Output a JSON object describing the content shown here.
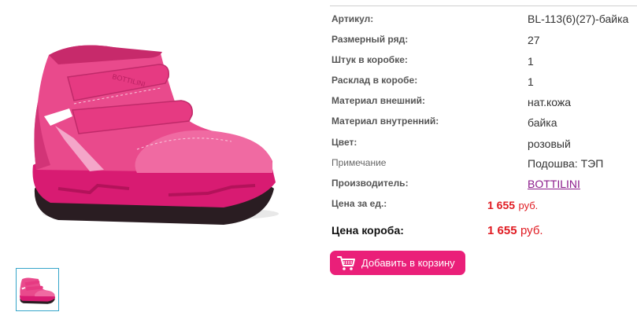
{
  "specs": [
    {
      "label": "Артикул:",
      "value": "BL-113(6)(27)-байка"
    },
    {
      "label": "Размерный ряд:",
      "value": "27"
    },
    {
      "label": "Штук в коробке:",
      "value": "1"
    },
    {
      "label": "Расклад в коробе:",
      "value": "1"
    },
    {
      "label": "Материал внешний:",
      "value": "нат.кожа"
    },
    {
      "label": "Материал внутренний:",
      "value": "байка"
    },
    {
      "label": "Цвет:",
      "value": "розовый"
    },
    {
      "label": "Примечание",
      "value": "Подошва: ТЭП"
    },
    {
      "label": "Производитель:",
      "value": "BOTTILINI"
    }
  ],
  "prices": {
    "unit_label": "Цена за ед.:",
    "unit_amount": "1 655",
    "unit_currency": "руб.",
    "box_label": "Цена короба:",
    "box_amount": "1 655",
    "box_currency": "руб."
  },
  "cart": {
    "label": "Добавить в корзину",
    "icon": "cart-icon"
  },
  "images": {
    "main_icon": "pink-boot-image",
    "thumb_icon": "pink-boot-thumbnail"
  },
  "colors": {
    "accent": "#ea1f79",
    "price": "#e01b22",
    "link": "#8b1a8b",
    "thumb_border": "#34a5c9"
  }
}
